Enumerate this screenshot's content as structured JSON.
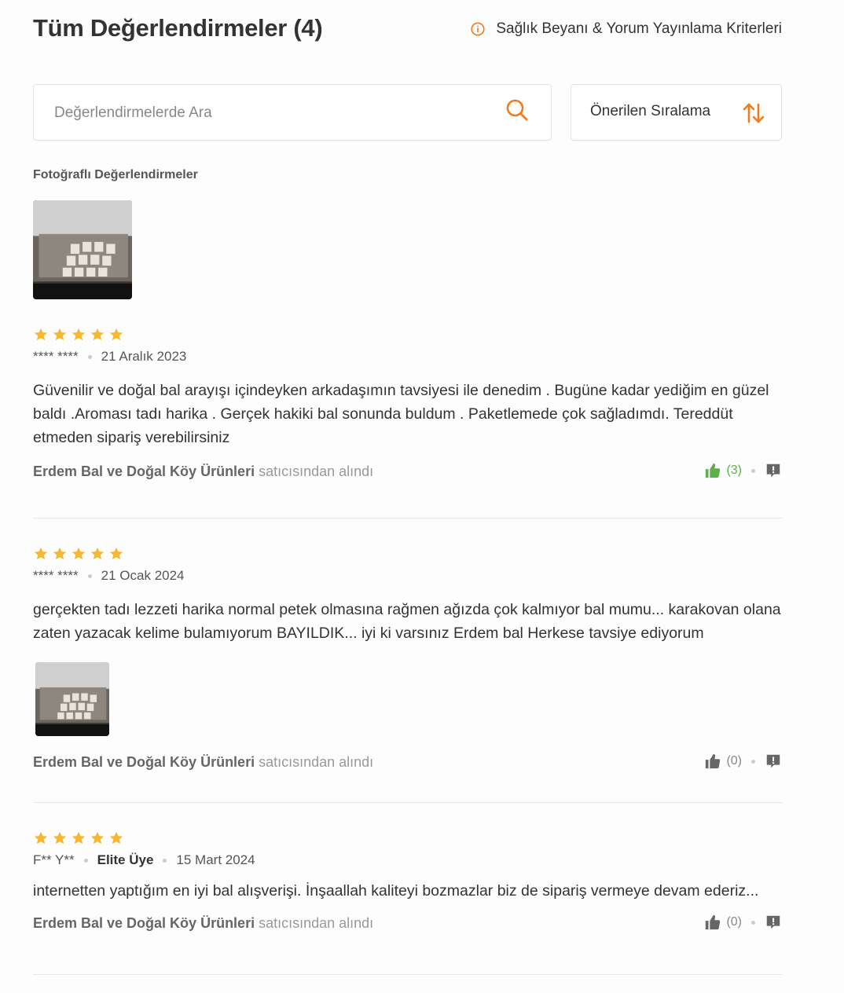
{
  "header": {
    "title": "Tüm Değerlendirmeler (4)",
    "criteria_link": "Sağlık Beyanı & Yorum Yayınlama Kriterleri"
  },
  "search": {
    "placeholder": "Değerlendirmelerde Ara",
    "value": ""
  },
  "sort": {
    "selected": "Önerilen Sıralama"
  },
  "photos_section": {
    "label": "Fotoğraflı Değerlendirmeler"
  },
  "colors": {
    "accent": "#f27a1a",
    "star": "#f6b830",
    "liked": "#5fb04a"
  },
  "reviews": [
    {
      "rating": 5,
      "author": "**** ****",
      "badge": "",
      "date": "21 Aralık 2023",
      "text": "Güvenilir ve doğal bal arayışı içindeyken arkadaşımın tavsiyesi ile denedim . Bugüne kadar yediğim en güzel baldı .Aroması tadı harika . Gerçek hakiki bal sonunda buldum . Paketlemede çok sağladımdı. Tereddüt etmeden sipariş verebilirsiniz",
      "seller_name": "Erdem Bal ve Doğal Köy Ürünleri",
      "seller_suffix": "satıcısından alındı",
      "likes": "(3)",
      "liked": true,
      "has_photo": false
    },
    {
      "rating": 5,
      "author": "**** ****",
      "badge": "",
      "date": "21 Ocak 2024",
      "text": "gerçekten tadı lezzeti harika normal petek olmasına rağmen ağızda çok kalmıyor bal mumu... karakovan olana zaten yazacak kelime bulamıyorum BAYILDIK... iyi ki varsınız Erdem bal Herkese tavsiye ediyorum",
      "seller_name": "Erdem Bal ve Doğal Köy Ürünleri",
      "seller_suffix": "satıcısından alındı",
      "likes": "(0)",
      "liked": false,
      "has_photo": true
    },
    {
      "rating": 5,
      "author": "F** Y**",
      "badge": "Elite Üye",
      "date": "15 Mart 2024",
      "text": "internetten yaptığım en iyi bal alışverişi. İnşaallah kaliteyi bozmazlar biz de sipariş vermeye devam ederiz...",
      "seller_name": "Erdem Bal ve Doğal Köy Ürünleri",
      "seller_suffix": "satıcısından alındı",
      "likes": "(0)",
      "liked": false,
      "has_photo": false
    }
  ]
}
